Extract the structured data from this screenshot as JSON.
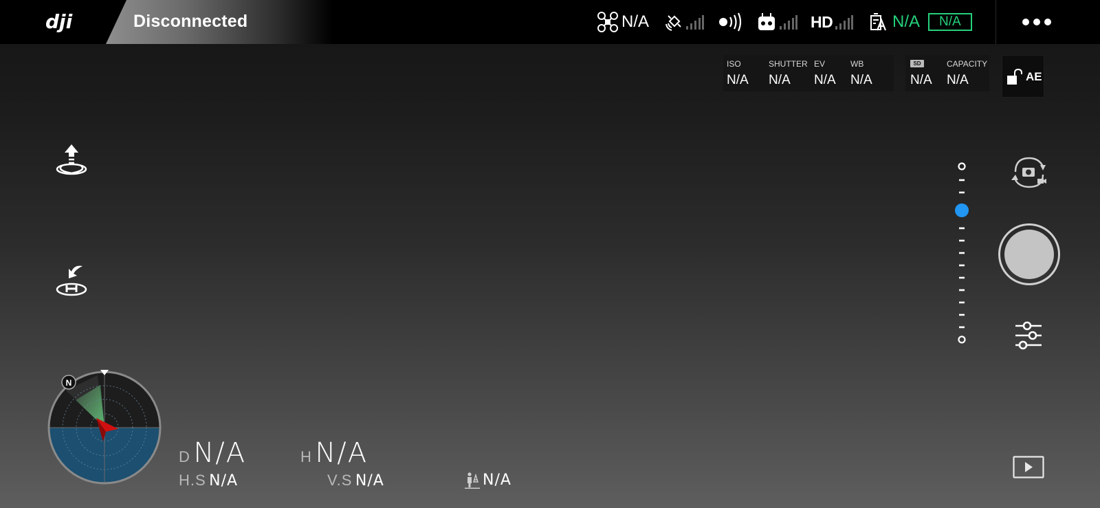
{
  "topbar": {
    "status": "Disconnected",
    "aircraft_label": "N/A",
    "hd_label": "HD",
    "battery_label": "N/A",
    "battery_box": "N/A",
    "green": "#26d07c"
  },
  "camera": {
    "params": [
      {
        "label": "ISO",
        "value": "N/A"
      },
      {
        "label": "SHUTTER",
        "value": "N/A"
      },
      {
        "label": "EV",
        "value": "N/A"
      },
      {
        "label": "WB",
        "value": "N/A"
      }
    ],
    "sd_badge": "SD",
    "sd_value": "N/A",
    "capacity_label": "CAPACITY",
    "capacity_value": "N/A",
    "ae_label": "AE"
  },
  "radar": {
    "north_label": "N",
    "sky_color": "#1c4f70"
  },
  "telemetry": {
    "distance_label": "D",
    "distance_value": "N/A",
    "height_label": "H",
    "height_value": "N/A",
    "hspeed_label": "H.S",
    "hspeed_value": "N/A",
    "vspeed_label": "V.S",
    "vspeed_value": "N/A",
    "vps_value": "N/A"
  },
  "slider": {
    "accent": "#2196f3"
  },
  "icons": [
    "dji-logo",
    "aircraft-icon",
    "gps-icon",
    "signal-icon",
    "obstacle-sensing-icon",
    "remote-controller-icon",
    "battery-icon",
    "more-icon",
    "lock-icon",
    "takeoff-icon",
    "return-home-icon",
    "camera-switch-icon",
    "settings-icon",
    "playback-icon",
    "vision-positioning-icon"
  ]
}
